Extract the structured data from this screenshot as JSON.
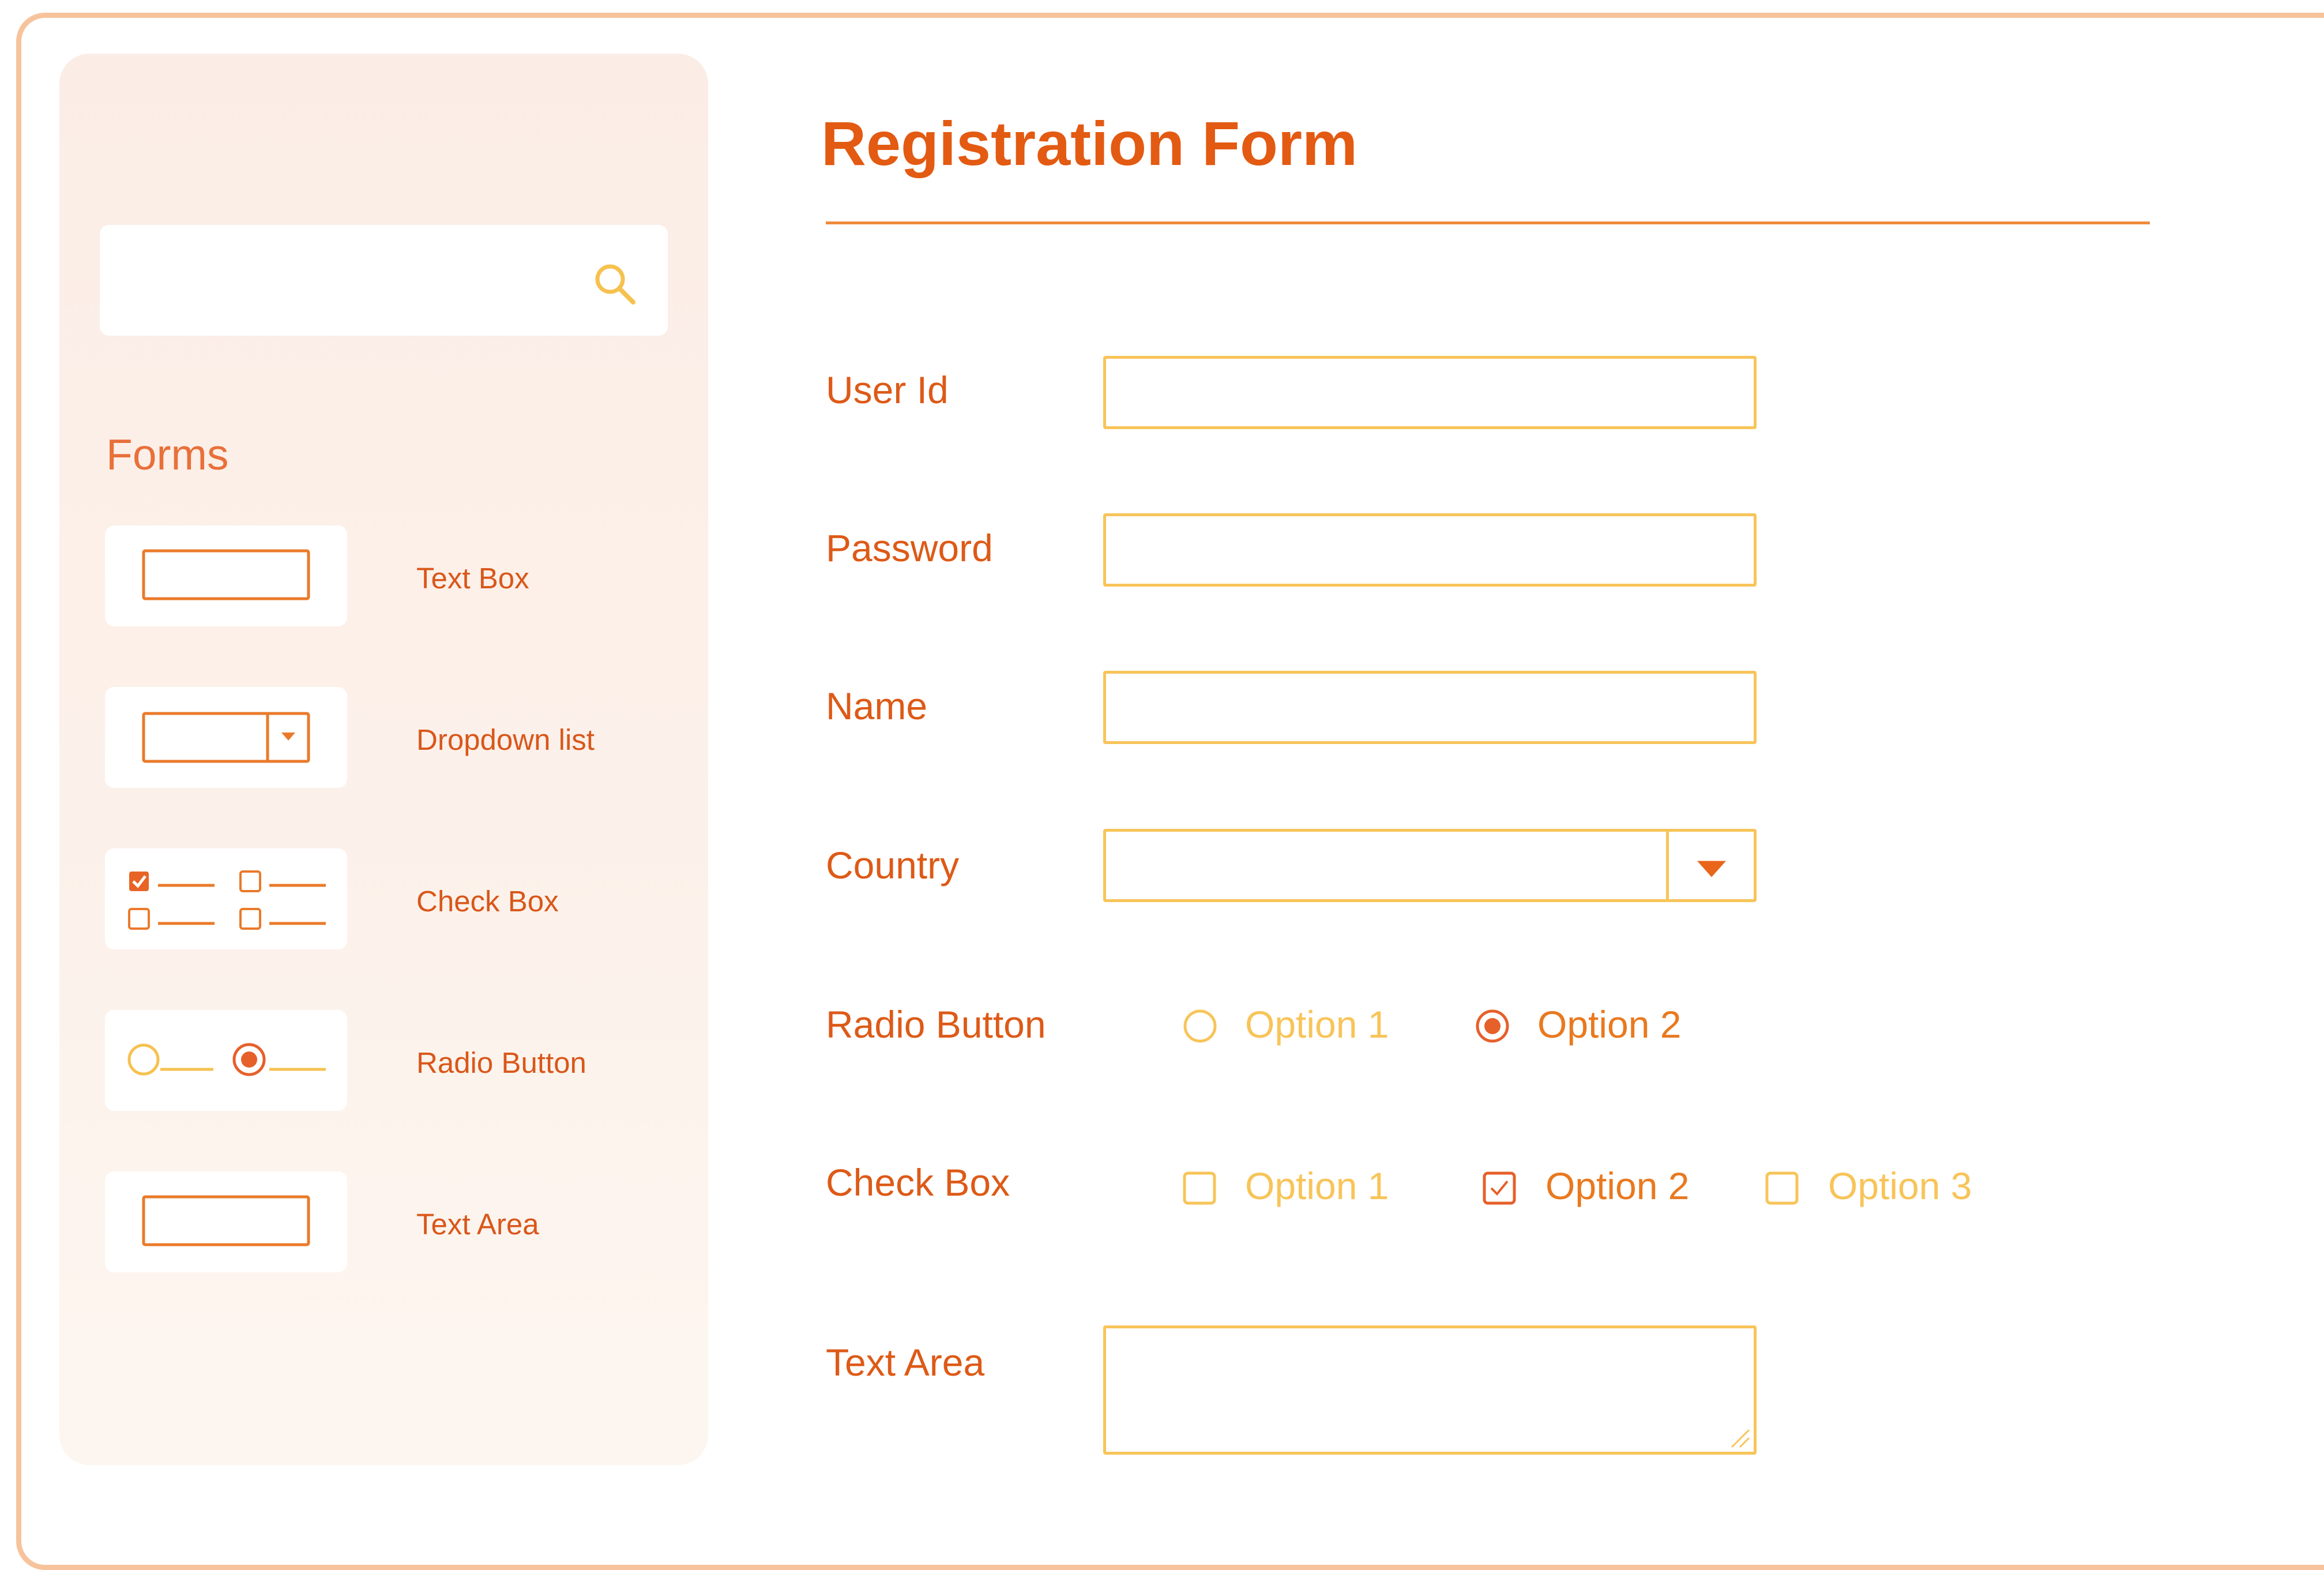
{
  "sidebar": {
    "search": {
      "placeholder": "",
      "icon": "search-icon"
    },
    "section_title": "Forms",
    "items": [
      {
        "label": "Text Box",
        "icon": "textbox-preview-icon"
      },
      {
        "label": "Dropdown list",
        "icon": "dropdown-preview-icon"
      },
      {
        "label": "Check Box",
        "icon": "checkbox-preview-icon"
      },
      {
        "label": "Radio Button",
        "icon": "radio-preview-icon"
      },
      {
        "label": "Text Area",
        "icon": "textarea-preview-icon"
      }
    ]
  },
  "form": {
    "title": "Registration Form",
    "fields": {
      "user_id": {
        "label": "User Id",
        "value": ""
      },
      "password": {
        "label": "Password",
        "value": ""
      },
      "name": {
        "label": "Name",
        "value": ""
      },
      "country": {
        "label": "Country",
        "selected": ""
      },
      "radio": {
        "label": "Radio Button",
        "options": [
          "Option 1",
          "Option 2"
        ],
        "selected": "Option 2"
      },
      "checkbox": {
        "label": "Check Box",
        "options": [
          "Option 1",
          "Option 2",
          "Option 3"
        ],
        "checked": [
          "Option 2"
        ]
      },
      "text_area": {
        "label": "Text Area",
        "value": ""
      }
    }
  },
  "colors": {
    "accent": "#e35a12",
    "label": "#dd5a17",
    "field_border": "#f8c459",
    "frame_border": "#f7c39c",
    "sidebar_bg": "#fbede6"
  }
}
